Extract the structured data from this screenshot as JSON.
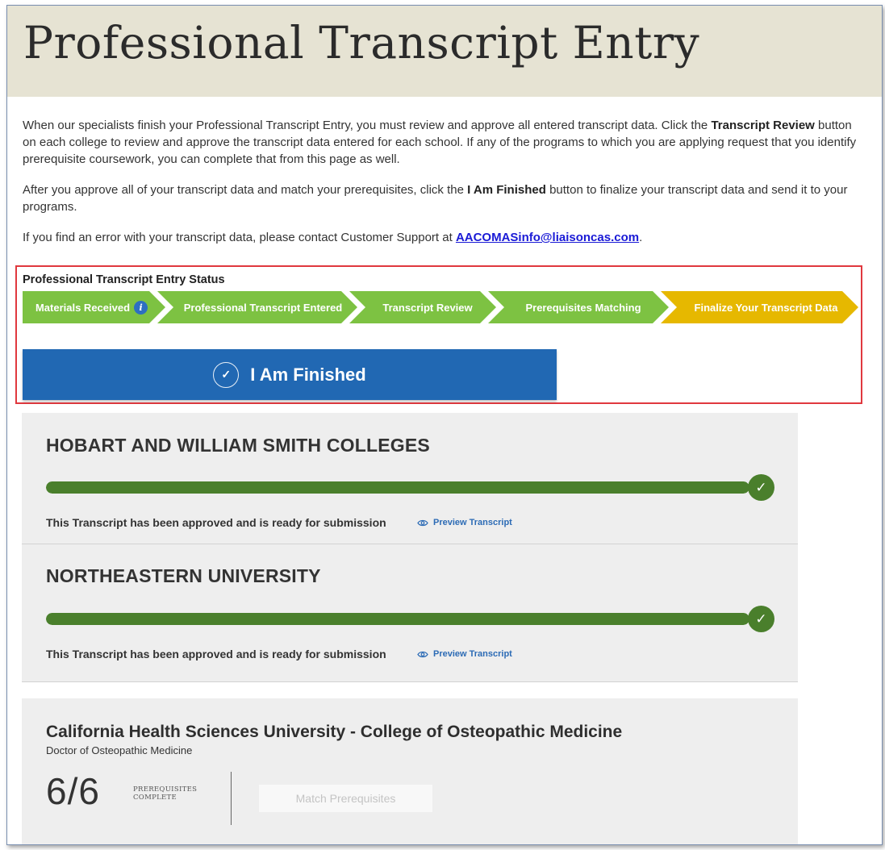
{
  "page": {
    "title": "Professional Transcript Entry"
  },
  "intro": {
    "p1_a": "When our specialists finish your Professional Transcript Entry, you must review and approve all entered transcript data. Click the",
    "p1_bold": "Transcript Review",
    "p1_b": "button on each college to review and approve the transcript data entered for each school. If any of the programs to which you are applying request that you identify prerequisite coursework, you can complete that from this page as well.",
    "p2_a": "After you approve all of your transcript data and match your prerequisites, click the",
    "p2_bold": "I Am Finished",
    "p2_b": "button to finalize your transcript data and send it to your programs.",
    "p3_a": "If you find an error with your transcript data, please contact Customer Support at",
    "p3_email": "AACOMASinfo@liaisoncas.com",
    "p3_b": "."
  },
  "status": {
    "title": "Professional Transcript Entry Status",
    "steps": [
      {
        "label": "Materials Received",
        "state": "complete",
        "info_icon": "info-icon"
      },
      {
        "label": "Professional Transcript Entered",
        "state": "complete"
      },
      {
        "label": "Transcript Review",
        "state": "complete"
      },
      {
        "label": "Prerequisites Matching",
        "state": "complete"
      },
      {
        "label": "Finalize Your Transcript Data",
        "state": "current"
      }
    ],
    "colors": {
      "complete": "#7dc242",
      "current": "#e6b800",
      "button": "#2168b3"
    },
    "finish_button": "I Am Finished"
  },
  "colleges": [
    {
      "name": "HOBART AND WILLIAM SMITH COLLEGES",
      "progress": 1.0,
      "status_text": "This Transcript has been approved and is ready for submission",
      "preview_label": "Preview Transcript"
    },
    {
      "name": "NORTHEASTERN UNIVERSITY",
      "progress": 1.0,
      "status_text": "This Transcript has been approved and is ready for submission",
      "preview_label": "Preview Transcript"
    }
  ],
  "program": {
    "name": "California Health Sciences University - College of Osteopathic Medicine",
    "degree": "Doctor of Osteopathic Medicine",
    "prereq_count": "6/6",
    "prereq_label_1": "PREREQUISITES",
    "prereq_label_2": "COMPLETE",
    "match_button": "Match Prerequisites"
  }
}
